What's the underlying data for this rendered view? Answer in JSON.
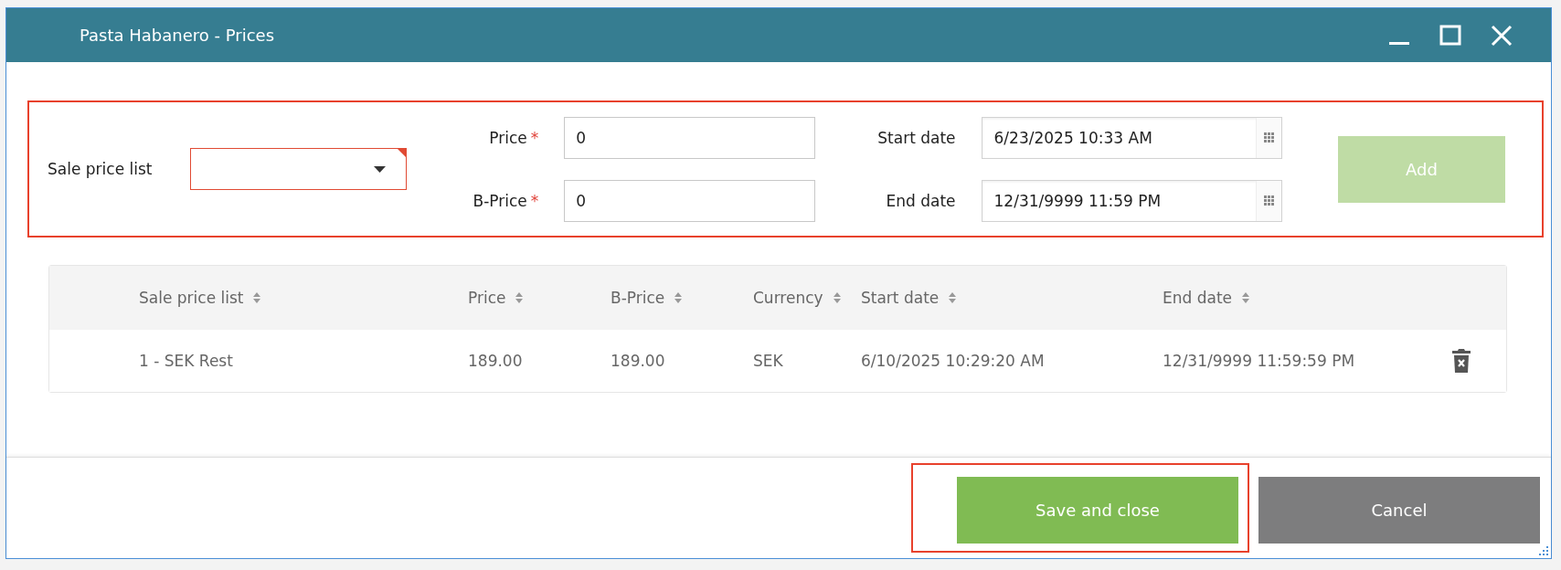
{
  "window": {
    "title": "Pasta Habanero - Prices"
  },
  "form": {
    "highlighted": true,
    "sale_price_list": {
      "label": "Sale price list",
      "invalid": true
    },
    "price": {
      "label": "Price",
      "required": true,
      "value": "0"
    },
    "b_price": {
      "label": "B-Price",
      "required": true,
      "value": "0"
    },
    "required_mark": "*",
    "start_date": {
      "label": "Start date",
      "value": "6/23/2025 10:33 AM"
    },
    "end_date": {
      "label": "End date",
      "value": "12/31/9999 11:59 PM"
    },
    "add_button": {
      "label": "Add",
      "disabled": true
    }
  },
  "table": {
    "columns": [
      {
        "label": "Sale price list",
        "sortable": true
      },
      {
        "label": "Price",
        "sortable": true
      },
      {
        "label": "B-Price",
        "sortable": true
      },
      {
        "label": "Currency",
        "sortable": true
      },
      {
        "label": "Start date",
        "sortable": true
      },
      {
        "label": "End date",
        "sortable": true
      }
    ],
    "rows": [
      {
        "cells": [
          "1 - SEK Rest",
          "189.00",
          "189.00",
          "SEK",
          "6/10/2025 10:29:20 AM",
          "12/31/9999 11:59:59 PM"
        ],
        "deletable": true
      }
    ]
  },
  "footer": {
    "buttons": [
      {
        "label": "Save and close",
        "kind": "primary",
        "highlighted": true
      },
      {
        "label": "Cancel",
        "kind": "secondary",
        "highlighted": false
      }
    ]
  }
}
